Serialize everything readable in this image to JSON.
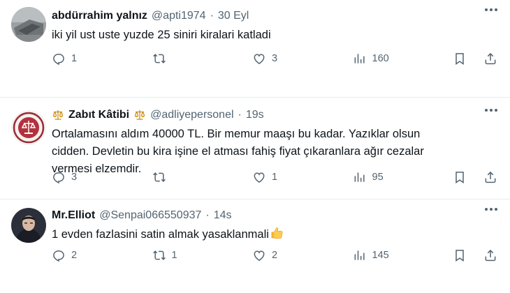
{
  "tweets": [
    {
      "name": "abdürrahim yalnız",
      "handle": "@apti1974",
      "time": "30 Eyl",
      "text": "iki yil ust uste yuzde 25 siniri kiralari katladi",
      "replies": "1",
      "retweets": "",
      "likes": "3",
      "views": "160",
      "avatar_icon": "gray-photo-avatar"
    },
    {
      "name": "Zabıt Kâtibi",
      "handle": "@adliyepersonel",
      "time": "19s",
      "text": "Ortalamasını aldım 40000 TL. Bir memur maaşı bu kadar. Yazıklar olsun\ncidden. Devletin bu kira işine el atması fahiş fiyat çıkaranlara ağır cezalar\nvermesi elzemdir.",
      "replies": "3",
      "retweets": "",
      "likes": "1",
      "views": "95",
      "avatar_icon": "court-seal-avatar",
      "name_emoji": "balance-scale-emoji"
    },
    {
      "name": "Mr.Elliot",
      "handle": "@Senpai066550937",
      "time": "14s",
      "text": "1 evden fazlasini satin almak yasaklanmali",
      "replies": "2",
      "retweets": "1",
      "likes": "2",
      "views": "145",
      "avatar_icon": "person-hooded-avatar",
      "text_emoji": "thumbs-up-emoji"
    }
  ],
  "separator": "·",
  "colors": {
    "text": "#0f1419",
    "secondary": "#536471",
    "divider": "#e6ecf0",
    "scale_gold": "#e2a127"
  }
}
